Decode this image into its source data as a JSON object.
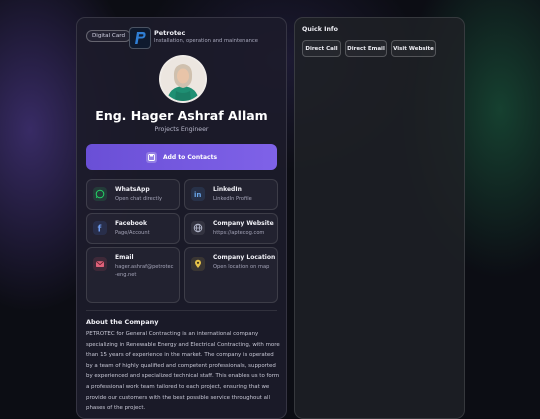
{
  "card": {
    "badge": "Digital Card",
    "brand": {
      "name": "Petrotec",
      "tagline": "Installation, operation and maintenance"
    },
    "person": {
      "name": "Eng. Hager Ashraf Allam",
      "role": "Projects Engineer"
    },
    "add_contact_label": "Add to Contacts",
    "contacts": [
      {
        "title": "WhatsApp",
        "sub": "Open chat directly",
        "icon": "whatsapp-icon",
        "color": "#25d366"
      },
      {
        "title": "LinkedIn",
        "sub": "LinkedIn Profile",
        "icon": "linkedin-icon",
        "color": "#4a8cd8"
      },
      {
        "title": "Facebook",
        "sub": "Page/Account",
        "icon": "facebook-icon",
        "color": "#4a7be0"
      },
      {
        "title": "Company Website",
        "sub": "https://aptecog.com",
        "icon": "globe-icon",
        "color": "#9aa0b8"
      },
      {
        "title": "Email",
        "sub": "hager.ashraf@petrotec-eng.net",
        "icon": "mail-icon",
        "color": "#e05a6e"
      },
      {
        "title": "Company Location",
        "sub": "Open location on map",
        "icon": "map-pin-icon",
        "color": "#e6c24a"
      }
    ],
    "about": {
      "title": "About the Company",
      "text": "PETROTEC for General Contracting is an international company specializing in Renewable Energy and Electrical Contracting, with more than 15 years of experience in the market. The company is operated by a team of highly qualified and competent professionals, supported by experienced and specialized technical staff. This enables us to form a professional work team tailored to each project, ensuring that we provide our customers with the best possible service throughout all phases of the project."
    }
  },
  "quick_info": {
    "title": "Quick Info",
    "buttons": [
      "Direct Call",
      "Direct Email",
      "Visit Website"
    ]
  }
}
